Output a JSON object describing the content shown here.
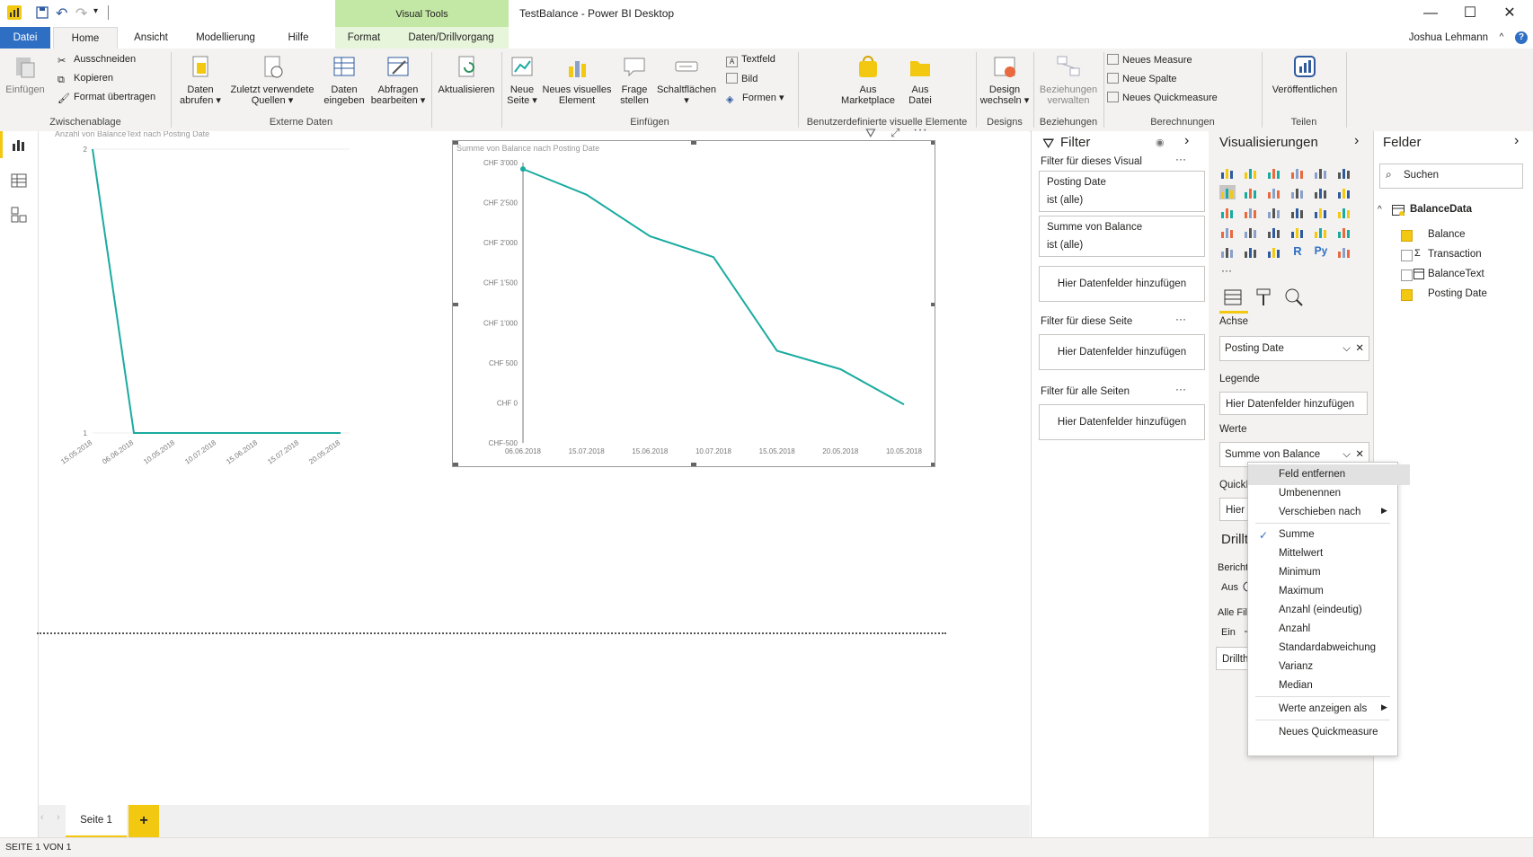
{
  "window": {
    "title": "TestBalance - Power BI Desktop",
    "visual_tools_label": "Visual Tools",
    "minimize": "—",
    "maximize": "☐",
    "close": "✕",
    "user": "Joshua Lehmann",
    "help": "?",
    "collapse": "^"
  },
  "tabs": {
    "file": "Datei",
    "home": "Home",
    "view": "Ansicht",
    "modeling": "Modellierung",
    "help": "Hilfe",
    "format": "Format",
    "drill": "Daten/Drillvorgang"
  },
  "ribbon": {
    "paste": "Einfügen",
    "cut": "Ausschneiden",
    "copy": "Kopieren",
    "format_painter": "Format übertragen",
    "clipboard_group": "Zwischenablage",
    "get_data_1": "Daten",
    "get_data_2": "abrufen ▾",
    "recent_1": "Zuletzt verwendete",
    "recent_2": "Quellen ▾",
    "enter_data_1": "Daten",
    "enter_data_2": "eingeben",
    "edit_queries_1": "Abfragen",
    "edit_queries_2": "bearbeiten ▾",
    "external_group": "Externe Daten",
    "refresh": "Aktualisieren",
    "new_page_1": "Neue",
    "new_page_2": "Seite ▾",
    "new_visual_1": "Neues visuelles",
    "new_visual_2": "Element",
    "ask_1": "Frage",
    "ask_2": "stellen",
    "buttons_1": "Schaltflächen",
    "buttons_2": "▾",
    "textbox": "Textfeld",
    "image": "Bild",
    "shapes": "Formen ▾",
    "insert_group": "Einfügen",
    "marketplace_1": "Aus",
    "marketplace_2": "Marketplace",
    "from_file_1": "Aus",
    "from_file_2": "Datei",
    "custom_group": "Benutzerdefinierte visuelle Elemente",
    "theme_1": "Design",
    "theme_2": "wechseln ▾",
    "designs_group": "Designs",
    "relations_1": "Beziehungen",
    "relations_2": "verwalten",
    "relations_group": "Beziehungen",
    "new_measure": "Neues Measure",
    "new_column": "Neue Spalte",
    "new_quick": "Neues Quickmeasure",
    "calc_group": "Berechnungen",
    "publish": "Veröffentlichen",
    "share_group": "Teilen"
  },
  "chart1": {
    "title": "Anzahl von BalanceText nach Posting Date"
  },
  "chart2": {
    "title": "Summe von  Balance  nach Posting Date"
  },
  "chart_data": [
    {
      "type": "line",
      "title": "Anzahl von BalanceText nach Posting Date",
      "x": [
        "15.05.2018",
        "06.06.2018",
        "10.05.2018",
        "10.07.2018",
        "15.06.2018",
        "15.07.2018",
        "20.05.2018"
      ],
      "series": [
        {
          "values": [
            2,
            1,
            1,
            1,
            1,
            1,
            1
          ]
        }
      ],
      "yticks": [
        "2",
        "1"
      ],
      "ylim": [
        1,
        2
      ],
      "color": "#1aaba0"
    },
    {
      "type": "line",
      "title": "Summe von  Balance  nach Posting Date",
      "x": [
        "06.06.2018",
        "15.07.2018",
        "15.06.2018",
        "10.07.2018",
        "15.05.2018",
        "20.05.2018",
        "10.05.2018"
      ],
      "series": [
        {
          "values": [
            2920,
            2600,
            2080,
            1820,
            650,
            420,
            -20
          ]
        }
      ],
      "yticks": [
        "CHF 3'000",
        "CHF 2'500",
        "CHF 2'000",
        "CHF 1'500",
        "CHF 1'000",
        "CHF 500",
        "CHF 0",
        "CHF-500"
      ],
      "ylim": [
        -500,
        3000
      ],
      "color": "#1aaba0"
    }
  ],
  "filter": {
    "title": "Filter",
    "this_visual": "Filter für dieses Visual",
    "card1_title": "Posting Date",
    "card1_sub": "ist (alle)",
    "card2_title": "Summe von Balance",
    "card2_sub": "ist (alle)",
    "add_fields": "Hier Datenfelder hinzufügen",
    "this_page": "Filter für diese Seite",
    "all_pages": "Filter für alle Seiten",
    "more": "···"
  },
  "vis": {
    "title": "Visualisierungen",
    "axis": "Achse",
    "axis_field": "Posting Date",
    "legend": "Legende",
    "legend_add": "Hier Datenfelder hinzufügen",
    "values": "Werte",
    "values_field": "Summe von Balance",
    "tooltip": "QuickInfo",
    "tooltip_add": "Hier Datenfelder hinzuf",
    "drill": "Drillthrough",
    "cross_report": "Berichtsübergreifend",
    "off": "Aus",
    "keep_filters": "Alle Filter beibehalten",
    "on": "Ein",
    "drill_add": "Drillthroughfelder hier h",
    "more": "···",
    "r_label": "R",
    "py_label": "Py"
  },
  "fields": {
    "title": "Felder",
    "search": "Suchen",
    "table": "BalanceData",
    "items": [
      "Balance",
      "Transaction",
      "BalanceText",
      "Posting Date"
    ]
  },
  "menu": {
    "items": [
      "Feld entfernen",
      "Umbenennen",
      "Verschieben nach",
      "Summe",
      "Mittelwert",
      "Minimum",
      "Maximum",
      "Anzahl (eindeutig)",
      "Anzahl",
      "Standardabweichung",
      "Varianz",
      "Median",
      "Werte anzeigen als",
      "Neues Quickmeasure"
    ]
  },
  "page": {
    "tab": "Seite 1",
    "add": "+",
    "status": "SEITE 1 VON 1"
  },
  "colors": {
    "accent_yellow": "#f2c811",
    "file_blue": "#2f6fc3",
    "line_teal": "#1aaba0"
  }
}
